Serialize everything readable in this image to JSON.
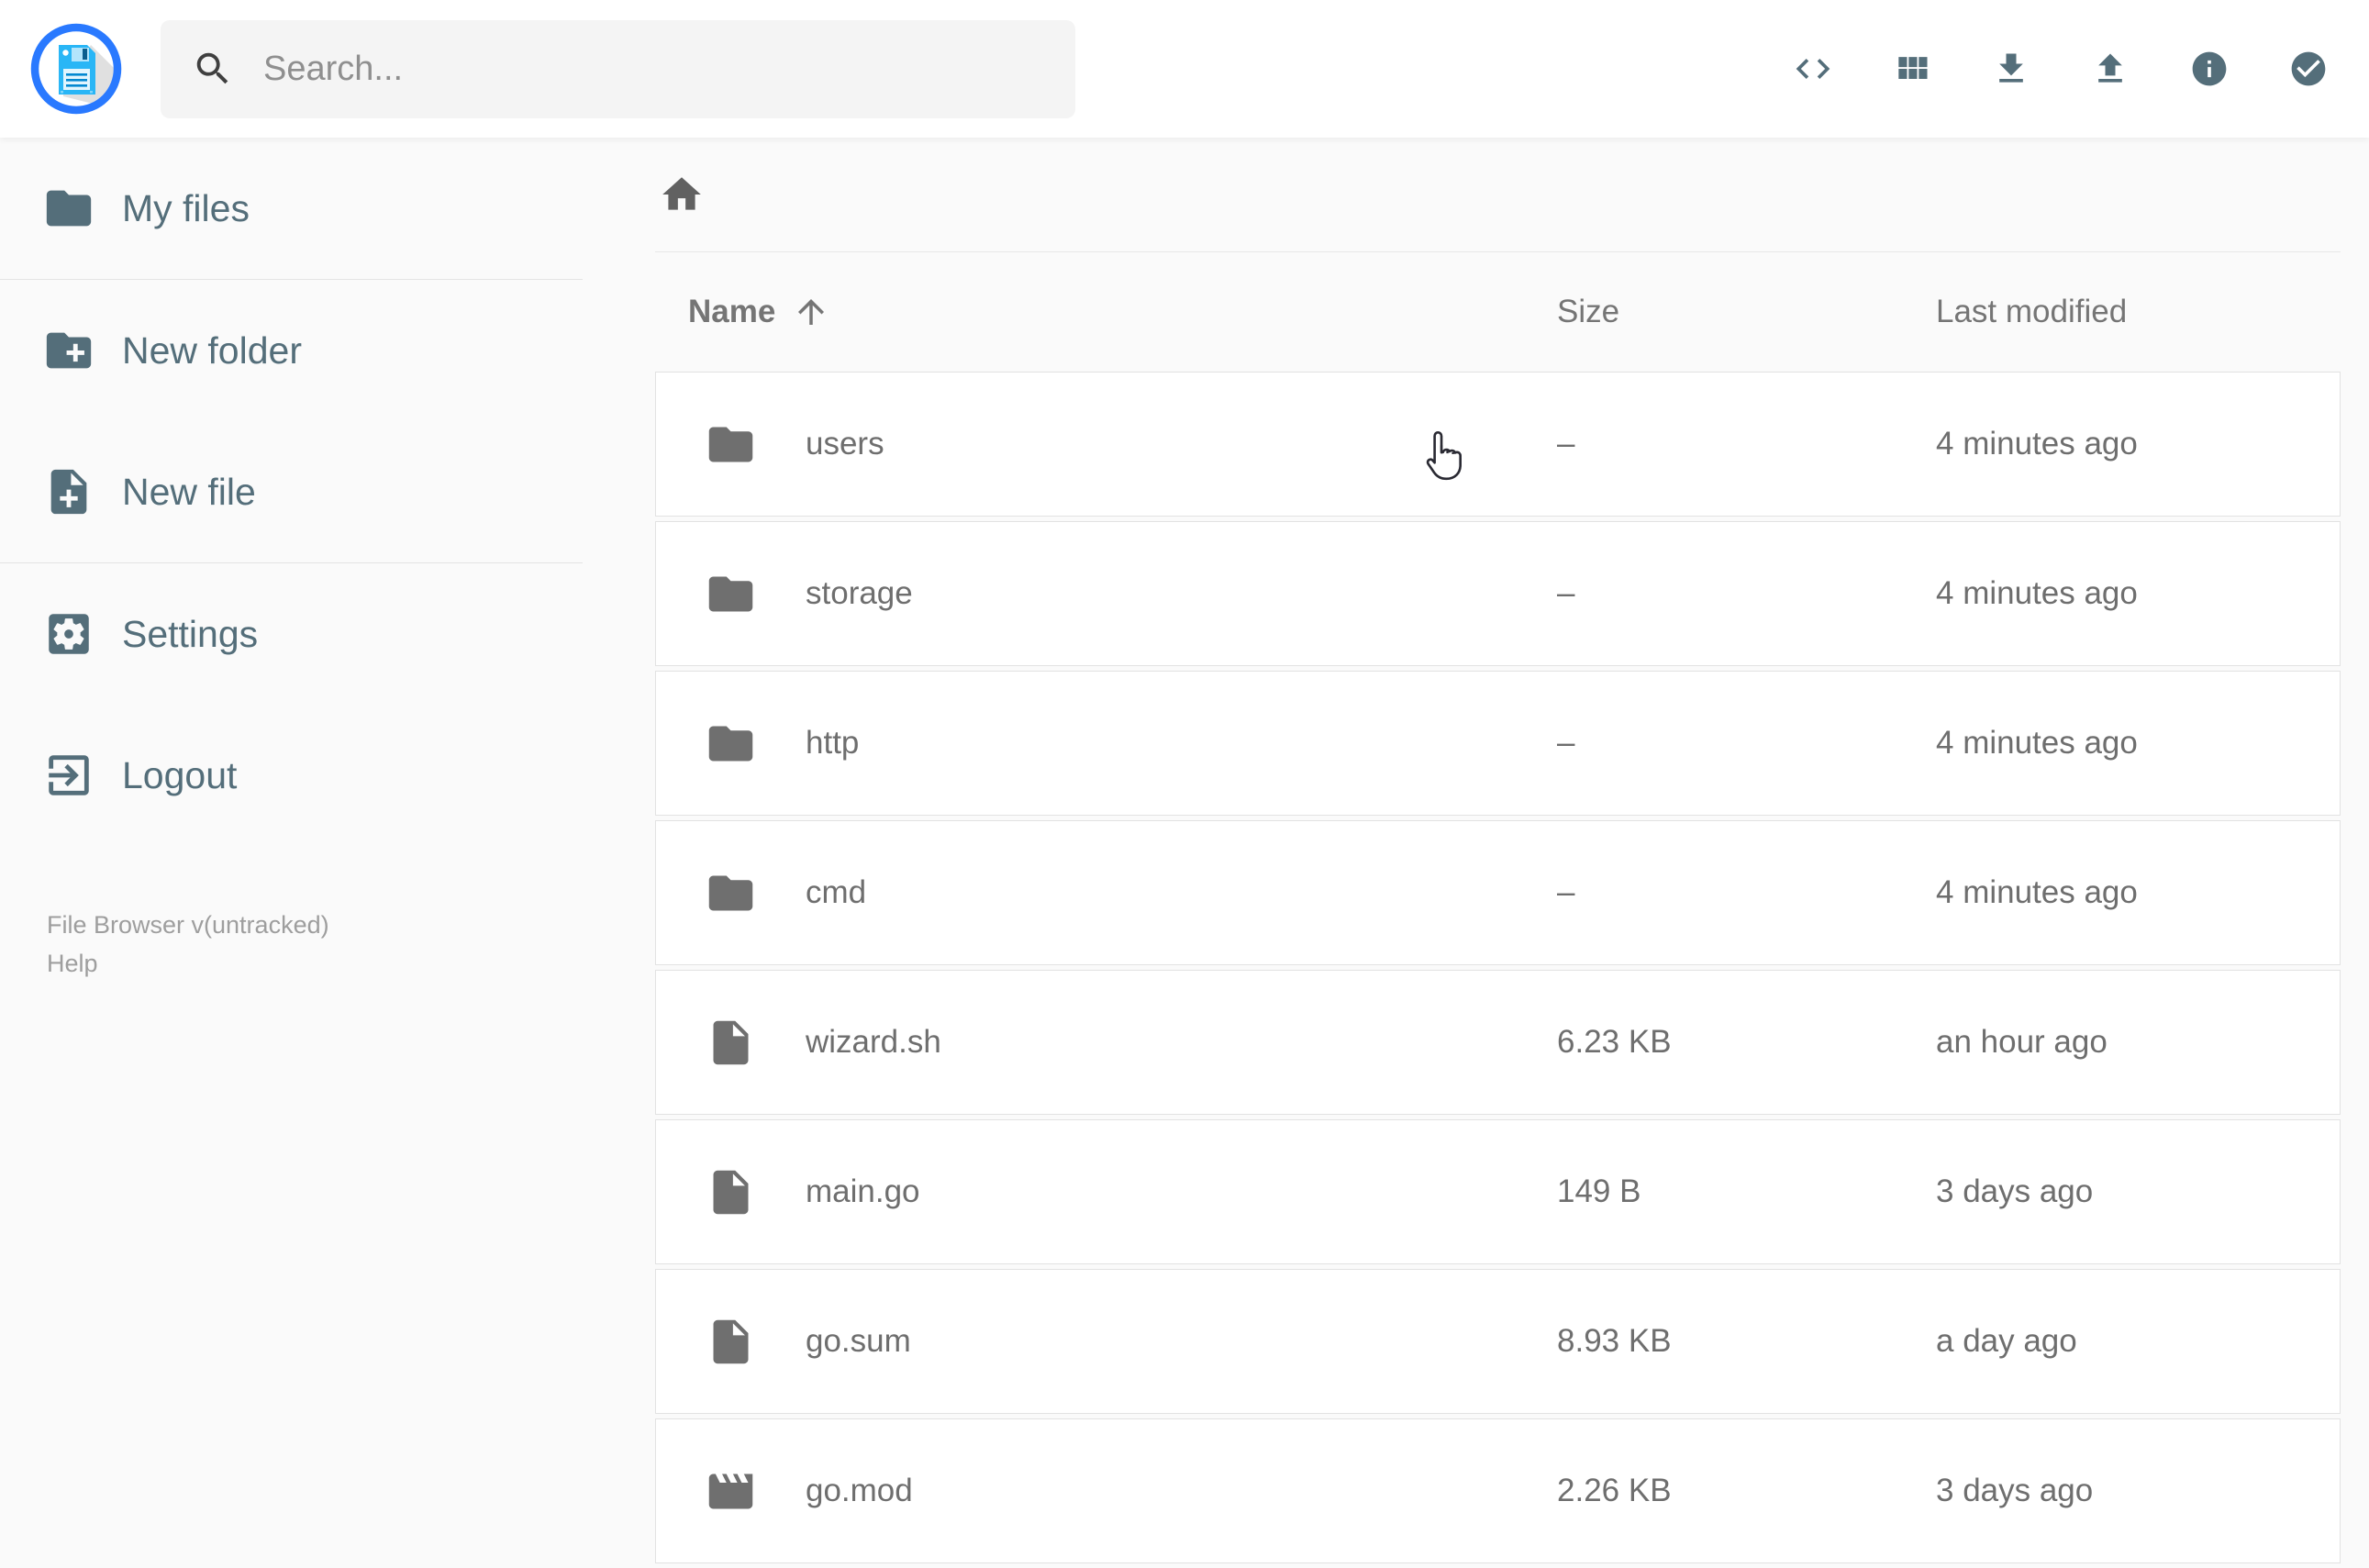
{
  "app": {
    "title": "File Browser"
  },
  "topbar": {
    "search": {
      "placeholder": "Search...",
      "icon": "search-icon"
    },
    "actions": [
      {
        "id": "raw-view",
        "icon": "code-icon"
      },
      {
        "id": "grid-view",
        "icon": "grid-view-icon"
      },
      {
        "id": "download",
        "icon": "download-icon"
      },
      {
        "id": "upload",
        "icon": "upload-icon"
      },
      {
        "id": "info",
        "icon": "info-icon"
      },
      {
        "id": "select-multiple",
        "icon": "check-circle-icon"
      }
    ]
  },
  "sidebar": {
    "items": [
      {
        "label": "My files",
        "icon": "folder-icon"
      },
      {
        "label": "New folder",
        "icon": "new-folder-icon"
      },
      {
        "label": "New file",
        "icon": "new-file-icon"
      },
      {
        "label": "Settings",
        "icon": "settings-icon"
      },
      {
        "label": "Logout",
        "icon": "logout-icon"
      }
    ],
    "footer": {
      "version": "File Browser v(untracked)",
      "help": "Help"
    }
  },
  "breadcrumb": {
    "home_icon": "home-icon"
  },
  "listing": {
    "columns": {
      "name": "Name",
      "size": "Size",
      "modified": "Last modified"
    },
    "sort": {
      "column": "name",
      "direction": "ascending"
    },
    "rows": [
      {
        "name": "users",
        "type": "folder",
        "size": "–",
        "modified": "4 minutes ago"
      },
      {
        "name": "storage",
        "type": "folder",
        "size": "–",
        "modified": "4 minutes ago"
      },
      {
        "name": "http",
        "type": "folder",
        "size": "–",
        "modified": "4 minutes ago"
      },
      {
        "name": "cmd",
        "type": "folder",
        "size": "–",
        "modified": "4 minutes ago"
      },
      {
        "name": "wizard.sh",
        "type": "file",
        "size": "6.23 KB",
        "modified": "an hour ago"
      },
      {
        "name": "main.go",
        "type": "file",
        "size": "149 B",
        "modified": "3 days ago"
      },
      {
        "name": "go.sum",
        "type": "file",
        "size": "8.93 KB",
        "modified": "a day ago"
      },
      {
        "name": "go.mod",
        "type": "video",
        "size": "2.26 KB",
        "modified": "3 days ago"
      }
    ]
  },
  "colors": {
    "accent_blue": "#2979ff",
    "logo_disk_blue": "#29b6f6",
    "icon_slate": "#546e7a",
    "listing_gray": "#6e6e6e",
    "page_background": "#fafafa",
    "topbar_background": "#ffffff"
  }
}
